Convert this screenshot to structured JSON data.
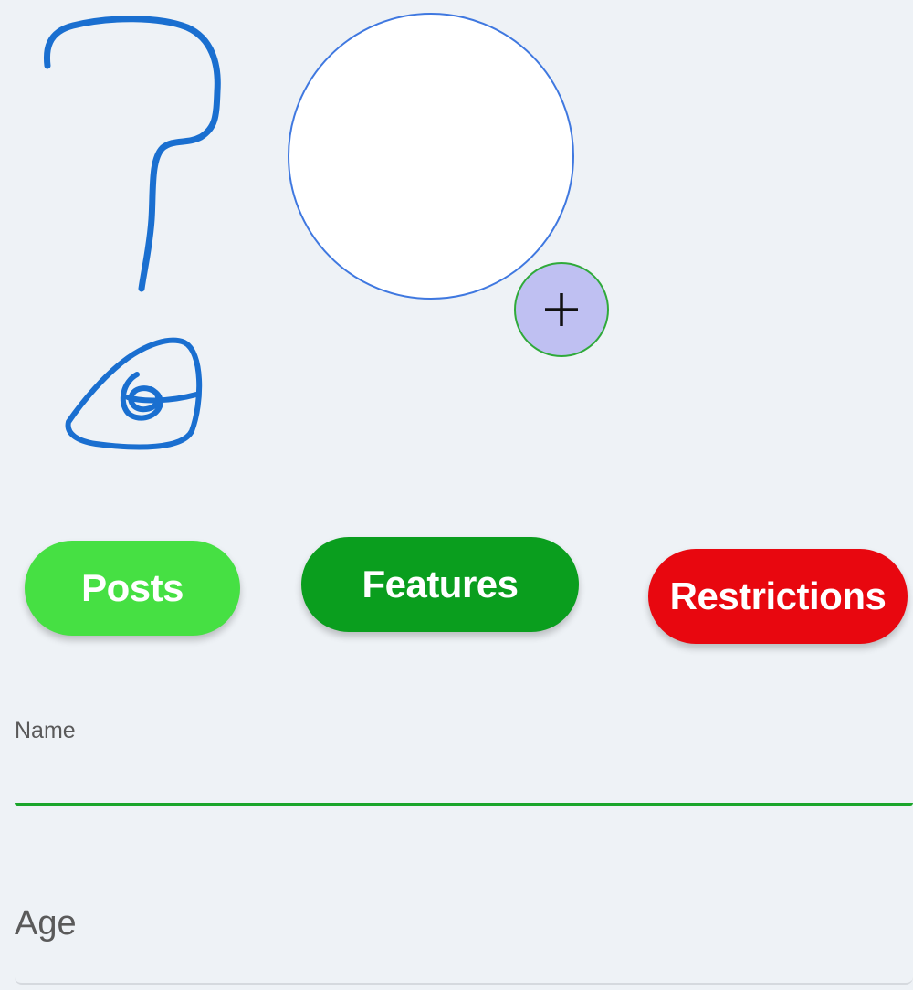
{
  "profile": {
    "placeholder_icon": "question-eye-scribble-icon",
    "avatar_icon": "avatar-circle",
    "add_button_label": "+"
  },
  "tabs": [
    {
      "label": "Posts",
      "color": "#46e043"
    },
    {
      "label": "Features",
      "color": "#0a9e1e"
    },
    {
      "label": "Restrictions",
      "color": "#e8070f"
    }
  ],
  "form": {
    "name": {
      "label": "Name",
      "value": ""
    },
    "age": {
      "label": "Age",
      "value": ""
    }
  },
  "colors": {
    "background": "#eef2f6",
    "scribble": "#1a6fd0",
    "active_underline": "#1aa52a",
    "add_button": "#bfc0f2"
  }
}
